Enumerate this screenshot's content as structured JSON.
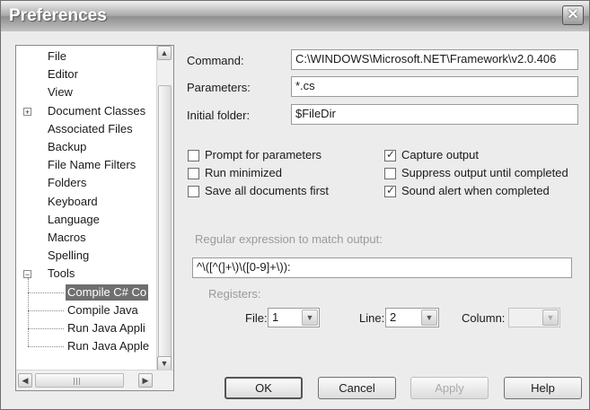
{
  "window": {
    "title": "Preferences"
  },
  "tree": {
    "items": [
      {
        "label": "File",
        "expander": ""
      },
      {
        "label": "Editor",
        "expander": ""
      },
      {
        "label": "View",
        "expander": ""
      },
      {
        "label": "Document Classes",
        "expander": "+"
      },
      {
        "label": "Associated Files",
        "expander": ""
      },
      {
        "label": "Backup",
        "expander": ""
      },
      {
        "label": "File Name Filters",
        "expander": ""
      },
      {
        "label": "Folders",
        "expander": ""
      },
      {
        "label": "Keyboard",
        "expander": ""
      },
      {
        "label": "Language",
        "expander": ""
      },
      {
        "label": "Macros",
        "expander": ""
      },
      {
        "label": "Spelling",
        "expander": ""
      },
      {
        "label": "Tools",
        "expander": "−"
      },
      {
        "label": "Compile C# Co",
        "selected": true
      },
      {
        "label": "Compile Java"
      },
      {
        "label": "Run Java Appli"
      },
      {
        "label": "Run Java Apple"
      }
    ]
  },
  "form": {
    "command_label": "Command:",
    "command_value": "C:\\WINDOWS\\Microsoft.NET\\Framework\\v2.0.406",
    "parameters_label": "Parameters:",
    "parameters_value": "*.cs",
    "initial_folder_label": "Initial folder:",
    "initial_folder_value": "$FileDir",
    "checkboxes_left": [
      {
        "label": "Prompt for parameters",
        "checked": false
      },
      {
        "label": "Run minimized",
        "checked": false
      },
      {
        "label": "Save all documents first",
        "checked": false
      }
    ],
    "checkboxes_right": [
      {
        "label": "Capture output",
        "checked": true
      },
      {
        "label": "Suppress output until completed",
        "checked": false
      },
      {
        "label": "Sound alert when completed",
        "checked": true
      }
    ],
    "regex_label": "Regular expression to match output:",
    "regex_value": "^\\([^(]+\\)\\([0-9]+\\)):",
    "registers_label": "Registers:",
    "file_label": "File:",
    "file_value": "1",
    "line_label": "Line:",
    "line_value": "2",
    "column_label": "Column:",
    "column_value": ""
  },
  "buttons": {
    "ok": "OK",
    "cancel": "Cancel",
    "apply": "Apply",
    "help": "Help"
  }
}
